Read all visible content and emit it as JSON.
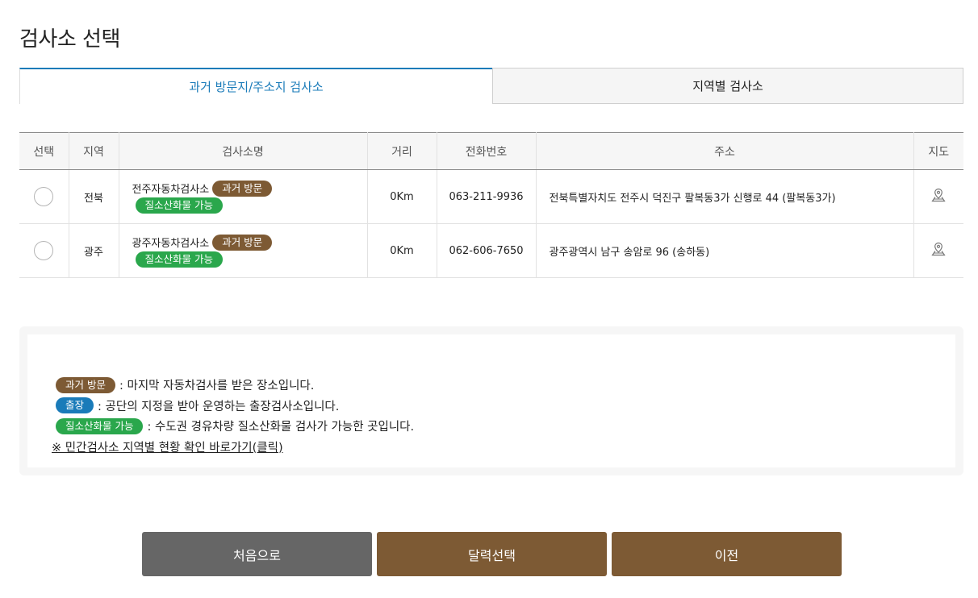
{
  "page_title": "검사소 선택",
  "tabs": [
    {
      "label": "과거 방문지/주소지 검사소",
      "active": true
    },
    {
      "label": "지역별 검사소",
      "active": false
    }
  ],
  "table": {
    "headers": [
      "선택",
      "지역",
      "검사소명",
      "거리",
      "전화번호",
      "주소",
      "지도"
    ],
    "rows": [
      {
        "region": "전북",
        "name": "전주자동차검사소",
        "badge_visit": "과거 방문",
        "badge_gas": "질소산화물 가능",
        "distance": "0Km",
        "phone": "063-211-9936",
        "address": "전북특별자치도 전주시 덕진구 팔복동3가 신행로 44 (팔복동3가)"
      },
      {
        "region": "광주",
        "name": "광주자동차검사소",
        "badge_visit": "과거 방문",
        "badge_gas": "질소산화물 가능",
        "distance": "0Km",
        "phone": "062-606-7650",
        "address": "광주광역시 남구 송암로 96 (송하동)"
      }
    ]
  },
  "legend": {
    "visit_badge": "과거 방문",
    "visit_text": ": 마지막 자동차검사를 받은 장소입니다.",
    "trip_badge": "출장",
    "trip_text": ": 공단의 지정을 받아 운영하는 출장검사소입니다.",
    "gas_badge": "질소산화물 가능",
    "gas_text": ": 수도권 경유차량 질소산화물 검사가 가능한 곳입니다.",
    "link_text": "※ 민간검사소 지역별 현황 확인 바로가기(클릭)"
  },
  "buttons": {
    "home": "처음으로",
    "calendar": "달력선택",
    "prev": "이전"
  },
  "colors": {
    "accent_blue": "#1a7bb9",
    "brown": "#7d5a34",
    "green": "#2aa74c",
    "gray_button": "#666666"
  },
  "icons": {
    "map": "map-pin-icon",
    "radio": "radio-button"
  }
}
